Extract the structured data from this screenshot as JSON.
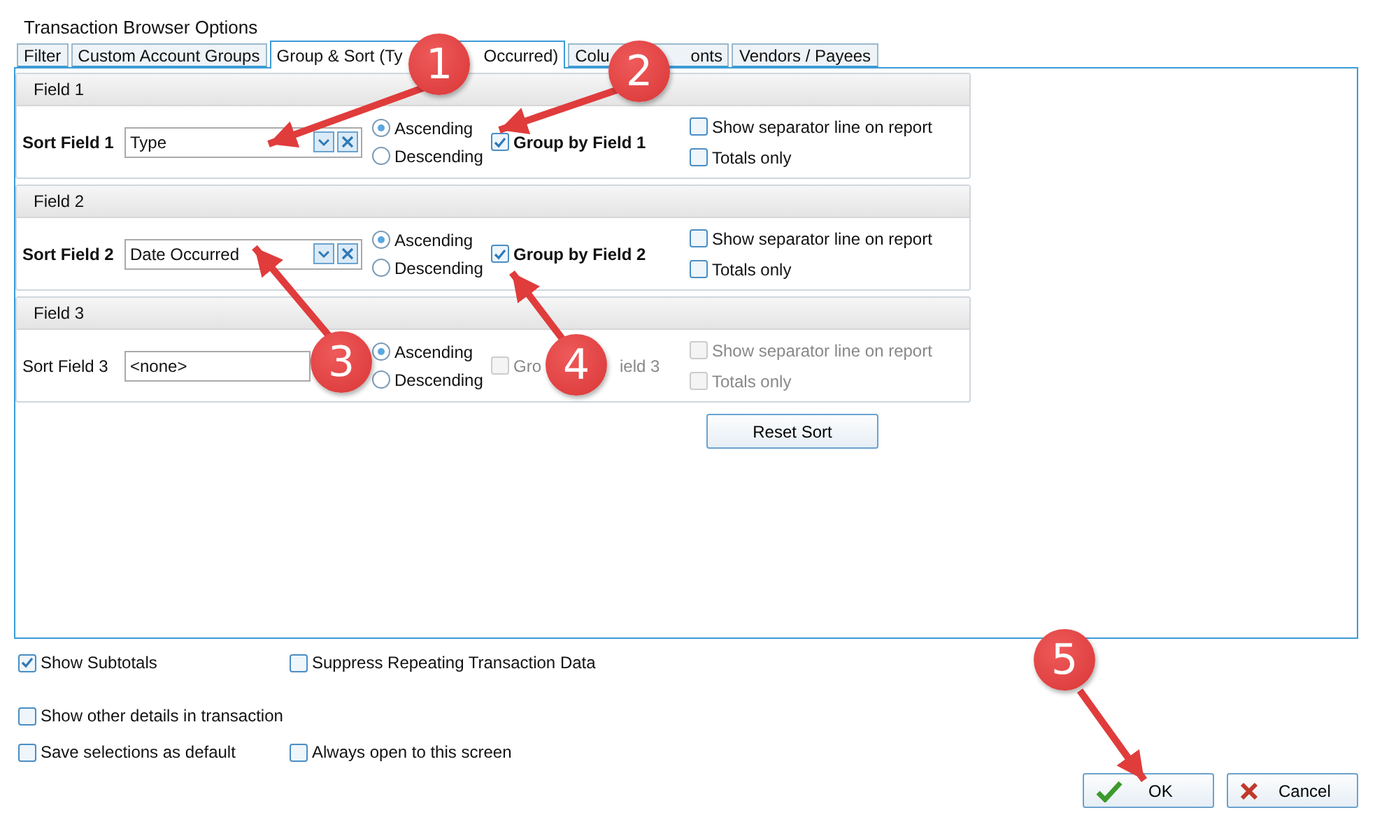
{
  "window": {
    "title": "Transaction Browser Options"
  },
  "tabs": [
    {
      "label": [
        "Filter"
      ],
      "selected": false
    },
    {
      "label": [
        "Custom Account Groups"
      ],
      "selected": false
    },
    {
      "label": [
        "Group & Sort (Ty",
        "Occurred)"
      ],
      "selected": true
    },
    {
      "label": [
        "Colu",
        "onts"
      ],
      "selected": false
    },
    {
      "label": [
        "Vendors / Payees"
      ],
      "selected": false
    }
  ],
  "fields": [
    {
      "header": "Field 1",
      "label": "Sort Field 1",
      "active": true,
      "value": "Type",
      "ascending": {
        "label": "Ascending",
        "selected": true
      },
      "descending": {
        "label": "Descending",
        "selected": false
      },
      "group": {
        "label": [
          "Group by Field 1"
        ],
        "checked": true,
        "disabled": false
      },
      "separator": {
        "label": "Show separator line on report",
        "checked": false,
        "disabled": false
      },
      "totals": {
        "label": "Totals only",
        "checked": false,
        "disabled": false
      }
    },
    {
      "header": "Field 2",
      "label": "Sort Field 2",
      "active": true,
      "value": "Date Occurred",
      "ascending": {
        "label": "Ascending",
        "selected": true
      },
      "descending": {
        "label": "Descending",
        "selected": false
      },
      "group": {
        "label": [
          "Group by Field 2"
        ],
        "checked": true,
        "disabled": false
      },
      "separator": {
        "label": "Show separator line on report",
        "checked": false,
        "disabled": false
      },
      "totals": {
        "label": "Totals only",
        "checked": false,
        "disabled": false
      }
    },
    {
      "header": "Field 3",
      "label": "Sort Field 3",
      "active": false,
      "value": "<none>",
      "ascending": {
        "label": "Ascending",
        "selected": true
      },
      "descending": {
        "label": "Descending",
        "selected": false
      },
      "group": {
        "label": [
          "Gro",
          "ield 3"
        ],
        "checked": false,
        "disabled": true
      },
      "separator": {
        "label": "Show separator line on report",
        "checked": false,
        "disabled": true
      },
      "totals": {
        "label": "Totals only",
        "checked": false,
        "disabled": true
      }
    }
  ],
  "reset_button": "Reset Sort",
  "options": [
    {
      "label": "Show Subtotals",
      "checked": true
    },
    {
      "label": "Suppress Repeating Transaction Data",
      "checked": false
    },
    {
      "label": "Show other details in transaction",
      "checked": false
    },
    {
      "label": "Save selections as default",
      "checked": false
    },
    {
      "label": "Always open to this screen",
      "checked": false
    }
  ],
  "buttons": [
    {
      "kind": "ok",
      "label": "OK"
    },
    {
      "kind": "cancel",
      "label": "Cancel"
    }
  ],
  "annotations": [
    {
      "number": "1"
    },
    {
      "number": "2"
    },
    {
      "number": "3"
    },
    {
      "number": "4"
    },
    {
      "number": "5"
    }
  ]
}
